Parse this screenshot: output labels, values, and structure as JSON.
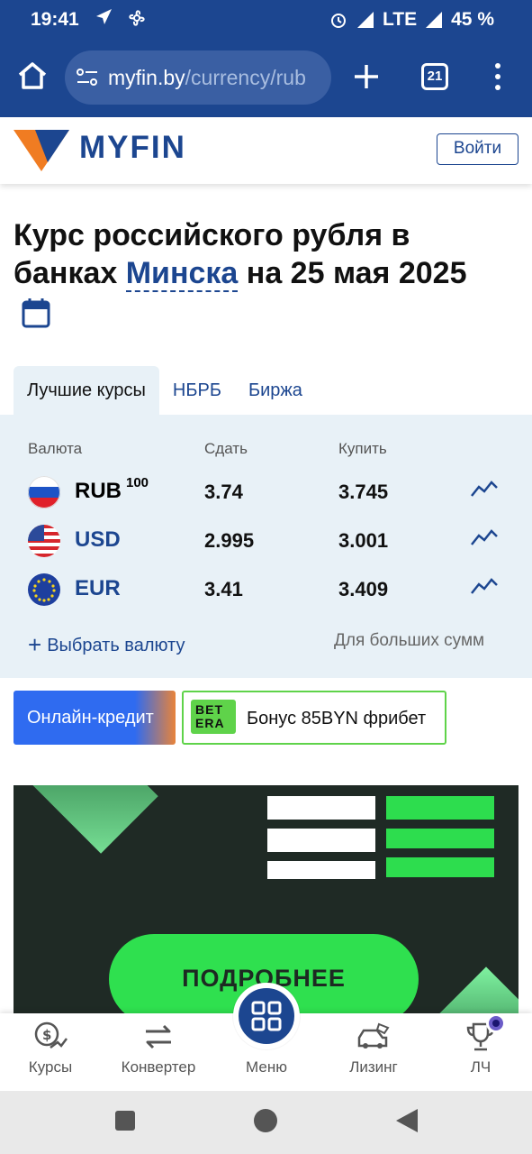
{
  "status_bar": {
    "time": "19:41",
    "network": "LTE",
    "battery": "45 %"
  },
  "browser": {
    "url_host": "myfin.by",
    "url_path": "/currency/rub",
    "tab_count": "21"
  },
  "header": {
    "logo_text": "MYFIN",
    "login_label": "Войти"
  },
  "page": {
    "title_part1": "Курс российского рубля в банках ",
    "title_city": "Минска",
    "title_part2": " на 25 мая 2025"
  },
  "tabs": [
    {
      "label": "Лучшие курсы",
      "active": true
    },
    {
      "label": "НБРБ",
      "active": false
    },
    {
      "label": "Биржа",
      "active": false
    }
  ],
  "rates_table": {
    "headers": {
      "currency": "Валюта",
      "sell": "Сдать",
      "buy": "Купить"
    },
    "rows": [
      {
        "code": "RUB",
        "unit": "100",
        "sell": "3.74",
        "buy": "3.745",
        "flag": "ru-flag-icon"
      },
      {
        "code": "USD",
        "unit": "",
        "sell": "2.995",
        "buy": "3.001",
        "flag": "us-flag-icon"
      },
      {
        "code": "EUR",
        "unit": "",
        "sell": "3.41",
        "buy": "3.409",
        "flag": "eu-flag-icon"
      }
    ],
    "pick_currency": "Выбрать валюту",
    "large_sums": "Для больших сумм"
  },
  "promo": {
    "credit_label": "Онлайн-кредит",
    "bonus_logo": "BET ERA",
    "bonus_label": "Бонус 85BYN фрибет"
  },
  "banner": {
    "cta": "ПОДРОБНЕЕ"
  },
  "bottom_nav": [
    {
      "label": "Курсы",
      "icon": "currency-icon"
    },
    {
      "label": "Конвертер",
      "icon": "convert-icon"
    },
    {
      "label": "Меню",
      "icon": "grid-icon"
    },
    {
      "label": "Лизинг",
      "icon": "car-icon"
    },
    {
      "label": "ЛЧ",
      "icon": "trophy-icon"
    }
  ],
  "colors": {
    "brand": "#1c4690",
    "panel": "#e8f1f7",
    "accent_green": "#2fe04f",
    "logo_orange": "#f07c22"
  }
}
